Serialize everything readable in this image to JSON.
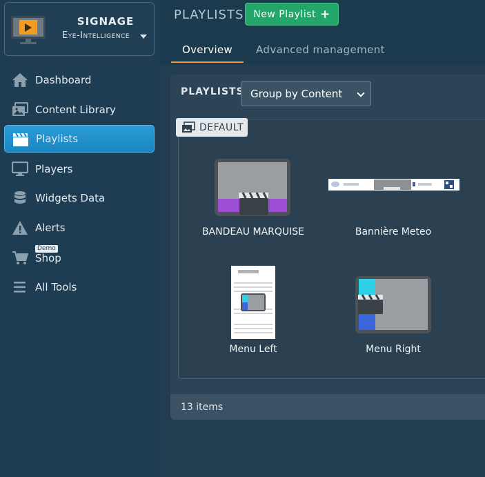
{
  "brand": {
    "title": "SIGNAGE",
    "subtitle": "Eye-Intelligence"
  },
  "sidebar": {
    "items": [
      {
        "label": "Dashboard",
        "icon": "home-icon"
      },
      {
        "label": "Content Library",
        "icon": "images-icon"
      },
      {
        "label": "Playlists",
        "icon": "clapperboard-icon",
        "active": true
      },
      {
        "label": "Players",
        "icon": "monitor-icon"
      },
      {
        "label": "Widgets Data",
        "icon": "database-icon"
      },
      {
        "label": "Alerts",
        "icon": "warning-icon"
      },
      {
        "label": "Shop",
        "icon": "cart-icon",
        "badge": "Demo"
      },
      {
        "label": "All Tools",
        "icon": "menu-icon"
      }
    ]
  },
  "header": {
    "title": "PLAYLISTS",
    "new_button": "New Playlist",
    "tabs": [
      {
        "label": "Overview",
        "active": true
      },
      {
        "label": "Advanced management"
      }
    ]
  },
  "panel": {
    "label": "PLAYLISTS",
    "group_select": "Group by Content",
    "group_name": "DEFAULT",
    "cards": [
      {
        "label": "BANDEAU MARQUISE"
      },
      {
        "label": "Bannière Meteo"
      },
      {
        "label": "Menu Left"
      },
      {
        "label": "Menu Right"
      }
    ],
    "footer_count": "13 items"
  },
  "colors": {
    "accent": "#1a86c2",
    "primary_button": "#23a66a",
    "tab_underline": "#e39a3c"
  }
}
